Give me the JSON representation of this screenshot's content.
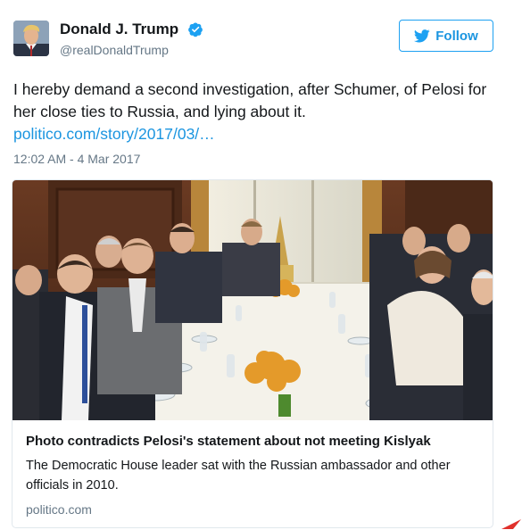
{
  "author": {
    "display_name": "Donald J. Trump",
    "handle": "@realDonaldTrump",
    "verified_icon": "verified-badge-icon"
  },
  "follow_button": {
    "label": "Follow",
    "icon": "twitter-bird-icon"
  },
  "tweet": {
    "text": "I hereby demand a second investigation, after Schumer, of Pelosi for her close ties to Russia, and lying about it.",
    "link": "politico.com/story/2017/03/…",
    "timestamp": "12:02 AM - 4 Mar 2017"
  },
  "card": {
    "title": "Photo contradicts Pelosi's statement about not meeting Kislyak",
    "description": "The Democratic House leader sat with the Russian ambassador and other officials in 2010.",
    "domain": "politico.com"
  },
  "colors": {
    "link": "#1b95e0",
    "accent": "#1da1f2",
    "secondary_text": "#657786",
    "border": "#e1e8ed",
    "corner_arrow": "#e0302b"
  }
}
